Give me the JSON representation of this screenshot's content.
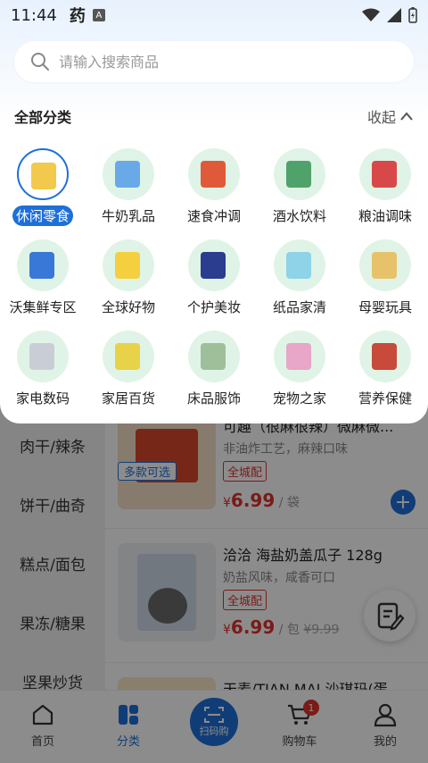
{
  "status_bar": {
    "time": "11:44",
    "app_glyph": "药",
    "notice_glyph": "A"
  },
  "search": {
    "placeholder": "请输入搜索商品"
  },
  "panel": {
    "title": "全部分类",
    "collapse_label": "收起"
  },
  "categories": [
    {
      "label": "休闲零食",
      "selected": true,
      "color": "#f2c94c"
    },
    {
      "label": "牛奶乳品",
      "selected": false,
      "color": "#6aa9e8"
    },
    {
      "label": "速食冲调",
      "selected": false,
      "color": "#e05a3a"
    },
    {
      "label": "酒水饮料",
      "selected": false,
      "color": "#4fa36a"
    },
    {
      "label": "粮油调味",
      "selected": false,
      "color": "#d94848"
    },
    {
      "label": "沃集鲜专区",
      "selected": false,
      "color": "#3a78d8"
    },
    {
      "label": "全球好物",
      "selected": false,
      "color": "#f4d03f"
    },
    {
      "label": "个护美妆",
      "selected": false,
      "color": "#2a3d8f"
    },
    {
      "label": "纸品家清",
      "selected": false,
      "color": "#8fd3e8"
    },
    {
      "label": "母婴玩具",
      "selected": false,
      "color": "#e8c26a"
    },
    {
      "label": "家电数码",
      "selected": false,
      "color": "#c9ced6"
    },
    {
      "label": "家居百货",
      "selected": false,
      "color": "#e8d24a"
    },
    {
      "label": "床品服饰",
      "selected": false,
      "color": "#9fbf9a"
    },
    {
      "label": "宠物之家",
      "selected": false,
      "color": "#e8a6c8"
    },
    {
      "label": "营养保健",
      "selected": false,
      "color": "#c84a3a"
    }
  ],
  "left_nav": [
    "肉干/辣条",
    "饼干/曲奇",
    "糕点/面包",
    "果冻/糖果",
    "坚果炒货"
  ],
  "products": [
    {
      "name": "可趣（很麻很辣）微麻微...",
      "desc": "非油炸工艺，麻辣口味",
      "tag": "全城配",
      "price": "6.99",
      "unit": "/ 袋",
      "old_price": "",
      "multi": "多款可选"
    },
    {
      "name": "洽洽 海盐奶盖瓜子 128g",
      "desc": "奶盐风味，咸香可口",
      "tag": "全城配",
      "price": "6.99",
      "unit": "/ 包",
      "old_price": "¥9.99",
      "multi": ""
    },
    {
      "name": "天麦/TIAN MAI 沙琪玛(蛋",
      "desc": "",
      "tag": "",
      "price": "",
      "unit": "",
      "old_price": "",
      "multi": ""
    }
  ],
  "currency": "¥",
  "tabbar": {
    "home": "首页",
    "category": "分类",
    "scan": "扫码购",
    "cart": "购物车",
    "cart_badge": "1",
    "mine": "我的"
  },
  "colors": {
    "accent": "#1e6fd9",
    "price": "#e0322d"
  }
}
